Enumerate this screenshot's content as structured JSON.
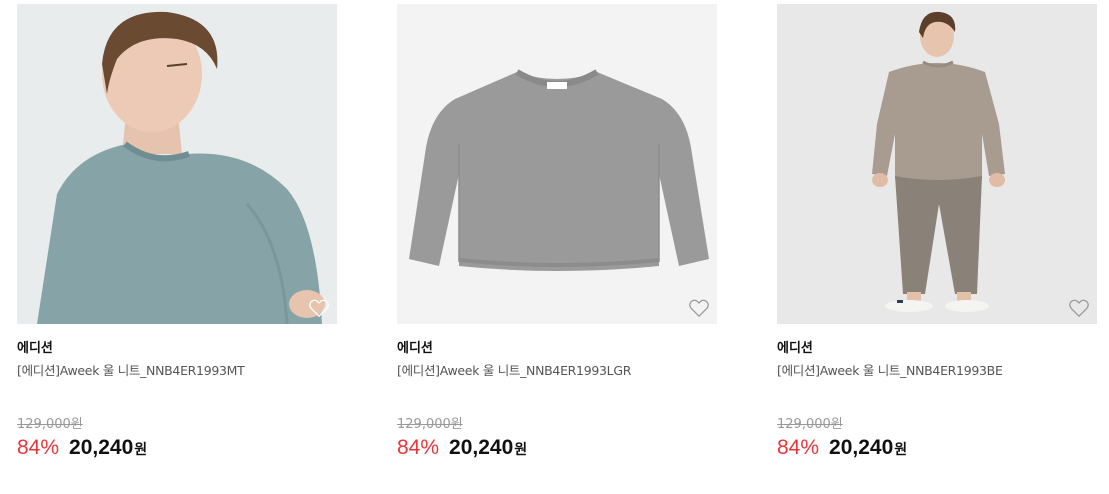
{
  "products": [
    {
      "brand": "에디션",
      "name": "[에디션]Aweek 울 니트_NNB4ER1993MT",
      "original_price": "129,000원",
      "discount": "84%",
      "price": "20,240",
      "currency": "원",
      "image": "model-wearing-mint-sweater",
      "sweater_color": "#86a4a8"
    },
    {
      "brand": "에디션",
      "name": "[에디션]Aweek 울 니트_NNB4ER1993LGR",
      "original_price": "129,000원",
      "discount": "84%",
      "price": "20,240",
      "currency": "원",
      "image": "flat-gray-sweater",
      "sweater_color": "#9a9a9a"
    },
    {
      "brand": "에디션",
      "name": "[에디션]Aweek 울 니트_NNB4ER1993BE",
      "original_price": "129,000원",
      "discount": "84%",
      "price": "20,240",
      "currency": "원",
      "image": "model-wearing-beige-sweater",
      "sweater_color": "#a89c90"
    }
  ],
  "colors": {
    "discount": "#e8353a",
    "price": "#111111",
    "original_price": "#999999"
  }
}
